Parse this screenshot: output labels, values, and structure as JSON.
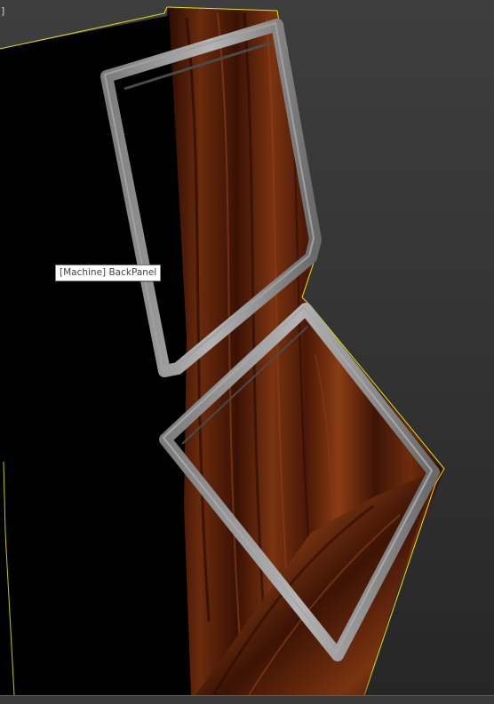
{
  "viewport": {
    "corner_label": "]",
    "selection_color": "#e6e600",
    "background_color": "#343434"
  },
  "tooltip": {
    "text": "[Machine] BackPanel"
  },
  "objects": [
    {
      "name": "BackPanel",
      "material": "wood-icon"
    },
    {
      "name": "upper-frame",
      "material": "metal-tube"
    },
    {
      "name": "lower-frame",
      "material": "metal-tube"
    }
  ]
}
